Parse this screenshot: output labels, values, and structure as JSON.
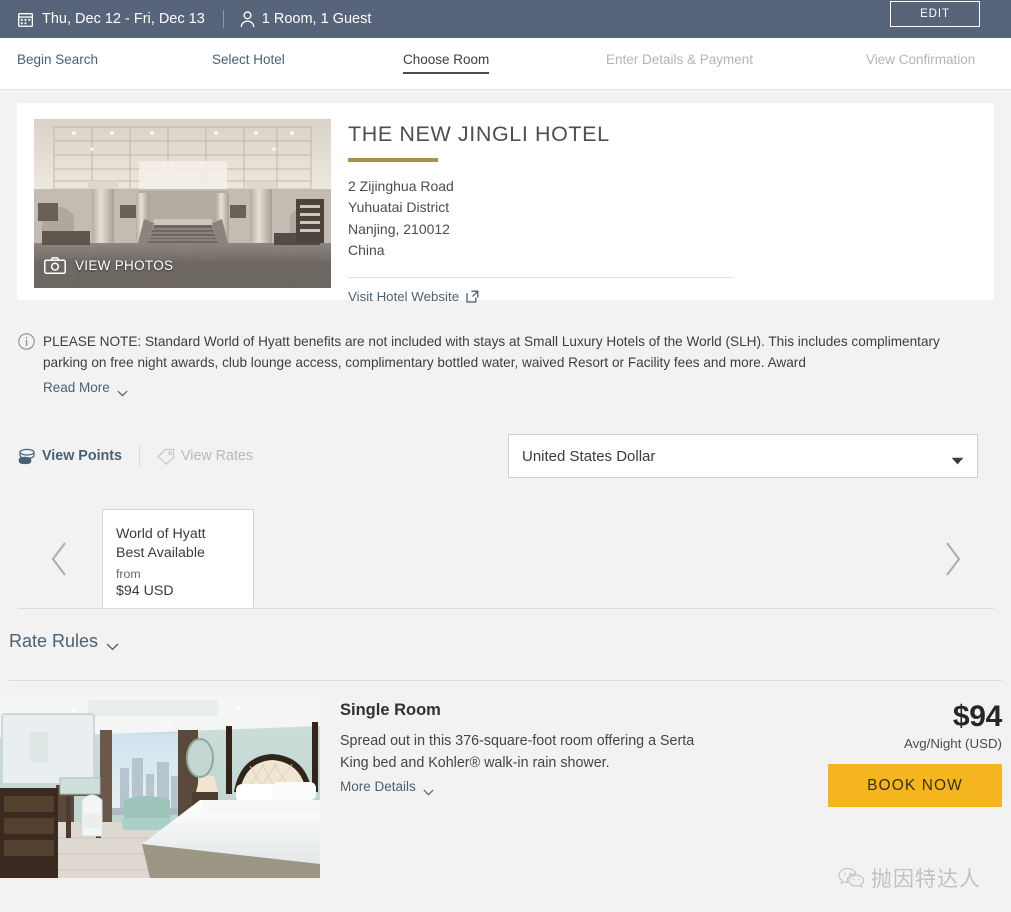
{
  "topbar": {
    "dates": "Thu, Dec 12 - Fri, Dec 13",
    "occupancy": "1 Room, 1 Guest",
    "edit_label": "EDIT",
    "calendar_icon": "calendar-icon",
    "person_icon": "person-icon",
    "background_color": "#586479"
  },
  "steps": [
    {
      "label": "Begin Search",
      "state": "done"
    },
    {
      "label": "Select Hotel",
      "state": "done"
    },
    {
      "label": "Choose Room",
      "state": "current"
    },
    {
      "label": "Enter Details & Payment",
      "state": "future"
    },
    {
      "label": "View Confirmation",
      "state": "future"
    }
  ],
  "hotel": {
    "name": "THE NEW JINGLI HOTEL",
    "accent_color": "#a6914e",
    "address": [
      "2 Zijinghua Road",
      "Yuhuatai District",
      "Nanjing, 210012",
      "China"
    ],
    "website_link": "Visit Hotel Website",
    "external_link_icon": "external-link-icon",
    "photo_overlay_label": "VIEW PHOTOS",
    "camera_icon": "camera-icon",
    "photo_alt": "hotel-lobby-photo"
  },
  "notice": {
    "info_icon": "info-icon",
    "text": "PLEASE NOTE: Standard World of Hyatt benefits are not included with stays at Small Luxury Hotels of the World (SLH). This includes complimentary parking on free night awards, club lounge access, complimentary bottled water, waived Resort or Facility fees and more. Award",
    "read_more_label": "Read More",
    "chevron_icon": "chevron-down-icon"
  },
  "view_toggle": {
    "points_label": "View Points",
    "points_icon": "points-coins-icon",
    "rates_label": "View Rates",
    "rates_icon": "price-tag-icon",
    "active": "View Points"
  },
  "currency": {
    "selected": "United States Dollar",
    "caret_icon": "caret-down-icon"
  },
  "carousel": {
    "prev_icon": "chevron-left-icon",
    "next_icon": "chevron-right-icon",
    "cards": [
      {
        "title_line1": "World of Hyatt",
        "title_line2": "Best Available",
        "from_label": "from",
        "price": "$94 USD"
      }
    ]
  },
  "rate_rules": {
    "label": "Rate Rules",
    "chevron_icon": "chevron-down-icon"
  },
  "rooms": [
    {
      "name": "Single Room",
      "description": "Spread out in this 376-square-foot room offering a Serta King bed and Kohler® walk-in rain shower.",
      "more_details_label": "More Details",
      "chevron_icon": "chevron-down-icon",
      "price": "$94",
      "price_sub": "Avg/Night (USD)",
      "book_label": "BOOK NOW",
      "book_color": "#f5b51e",
      "photo_alt": "guest-room-photo"
    }
  ],
  "watermark": {
    "text": "抛因特达人",
    "icon": "wechat-icon"
  }
}
